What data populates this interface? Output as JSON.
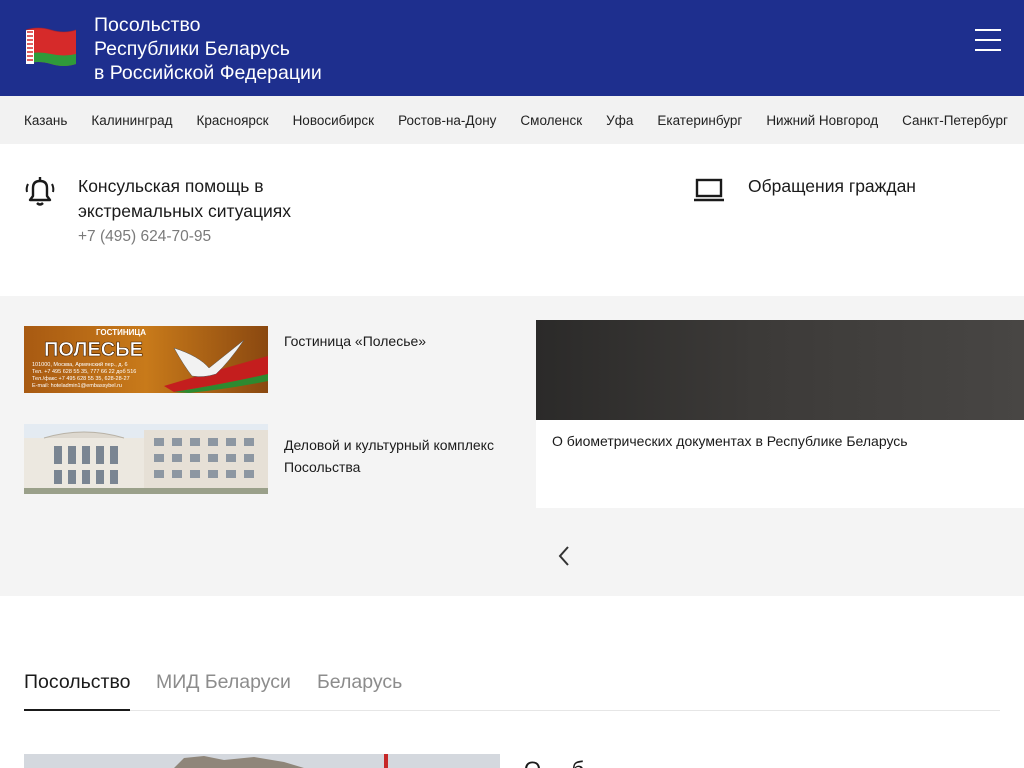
{
  "header": {
    "title_lines": [
      "Посольство",
      "Республики Беларусь",
      "в Российской Федерации"
    ],
    "flag_icon": "belarus-flag-icon",
    "menu_icon": "hamburger-menu-icon",
    "colors": {
      "background": "#1e2f8e",
      "text": "#ffffff"
    }
  },
  "cities": [
    "Казань",
    "Калининград",
    "Красноярск",
    "Новосибирск",
    "Ростов-на-Дону",
    "Смоленск",
    "Уфа",
    "Екатеринбург",
    "Нижний Новгород",
    "Санкт-Петербург"
  ],
  "contacts": {
    "help_icon": "alarm-bell-icon",
    "help_title": "Консульская помощь в экстремальных ситуациях",
    "help_phone": "+7 (495) 624-70-95",
    "appeals_icon": "laptop-icon",
    "appeals_label": "Обращения граждан"
  },
  "promos": {
    "hotel_banner": {
      "heading": "ГОСТИНИЦА",
      "name": "ПОЛЕСЬЕ",
      "lines": [
        "101000, Москва, Армянский пер., д. 6",
        "Тел. +7 495 628 55 35, 777 66 22 доб 516",
        "Тел./факс +7 495 628 55 35, 628-28-27",
        "E-mail: hoteladmin1@embassybel.ru"
      ]
    },
    "items": [
      {
        "label": "Гостиница «Полесье»"
      },
      {
        "label": "Деловой и культурный комплекс Посольства"
      }
    ],
    "card_label": "О биометрических документах в Республике Беларусь",
    "prev_icon": "chevron-left-icon"
  },
  "tabs": [
    {
      "label": "Посольство",
      "active": true
    },
    {
      "label": "МИД Беларуси",
      "active": false
    },
    {
      "label": "Беларусь",
      "active": false
    }
  ],
  "bottom": {
    "title_partial": "О ... б"
  }
}
